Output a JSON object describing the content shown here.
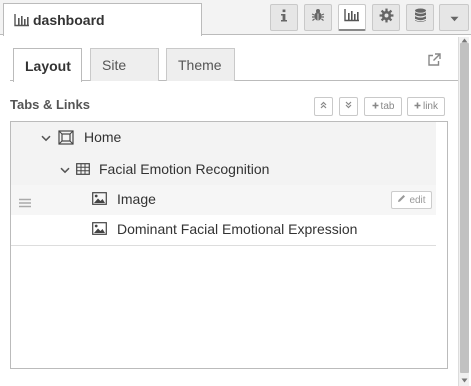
{
  "header": {
    "sidebar_tab_label": "dashboard",
    "buttons": [
      {
        "name": "info-button",
        "icon": "info-icon"
      },
      {
        "name": "debug-button",
        "icon": "bug-icon"
      },
      {
        "name": "dashboard-button",
        "icon": "bar-chart-icon",
        "selected": true
      },
      {
        "name": "config-button",
        "icon": "gear-icon"
      },
      {
        "name": "context-data-button",
        "icon": "database-icon"
      },
      {
        "name": "sidebar-menu-button",
        "icon": "caret-down-icon"
      }
    ]
  },
  "tabs": [
    {
      "label": "Layout",
      "active": true
    },
    {
      "label": "Site",
      "active": false
    },
    {
      "label": "Theme",
      "active": false
    }
  ],
  "section": {
    "title": "Tabs & Links",
    "expand_all_icon": "double-chevron-up-icon",
    "collapse_all_icon": "double-chevron-down-icon",
    "add_tab_label": "tab",
    "add_link_label": "link"
  },
  "tree": {
    "tab": {
      "label": "Home",
      "icon": "tab-icon",
      "expanded": true
    },
    "group": {
      "label": "Facial Emotion Recognition",
      "icon": "table-icon",
      "expanded": true
    },
    "widgets": [
      {
        "label": "Image",
        "icon": "image-icon",
        "edit_label": "edit"
      },
      {
        "label": "Dominant Facial Emotional Expression",
        "icon": "image-icon"
      }
    ]
  },
  "colors": {
    "header_bg": "#f3f3f3",
    "border": "#bbbbbb",
    "selected_row_bg": "#f3f3f3",
    "scrollbar_thumb": "#c1c1c1"
  }
}
